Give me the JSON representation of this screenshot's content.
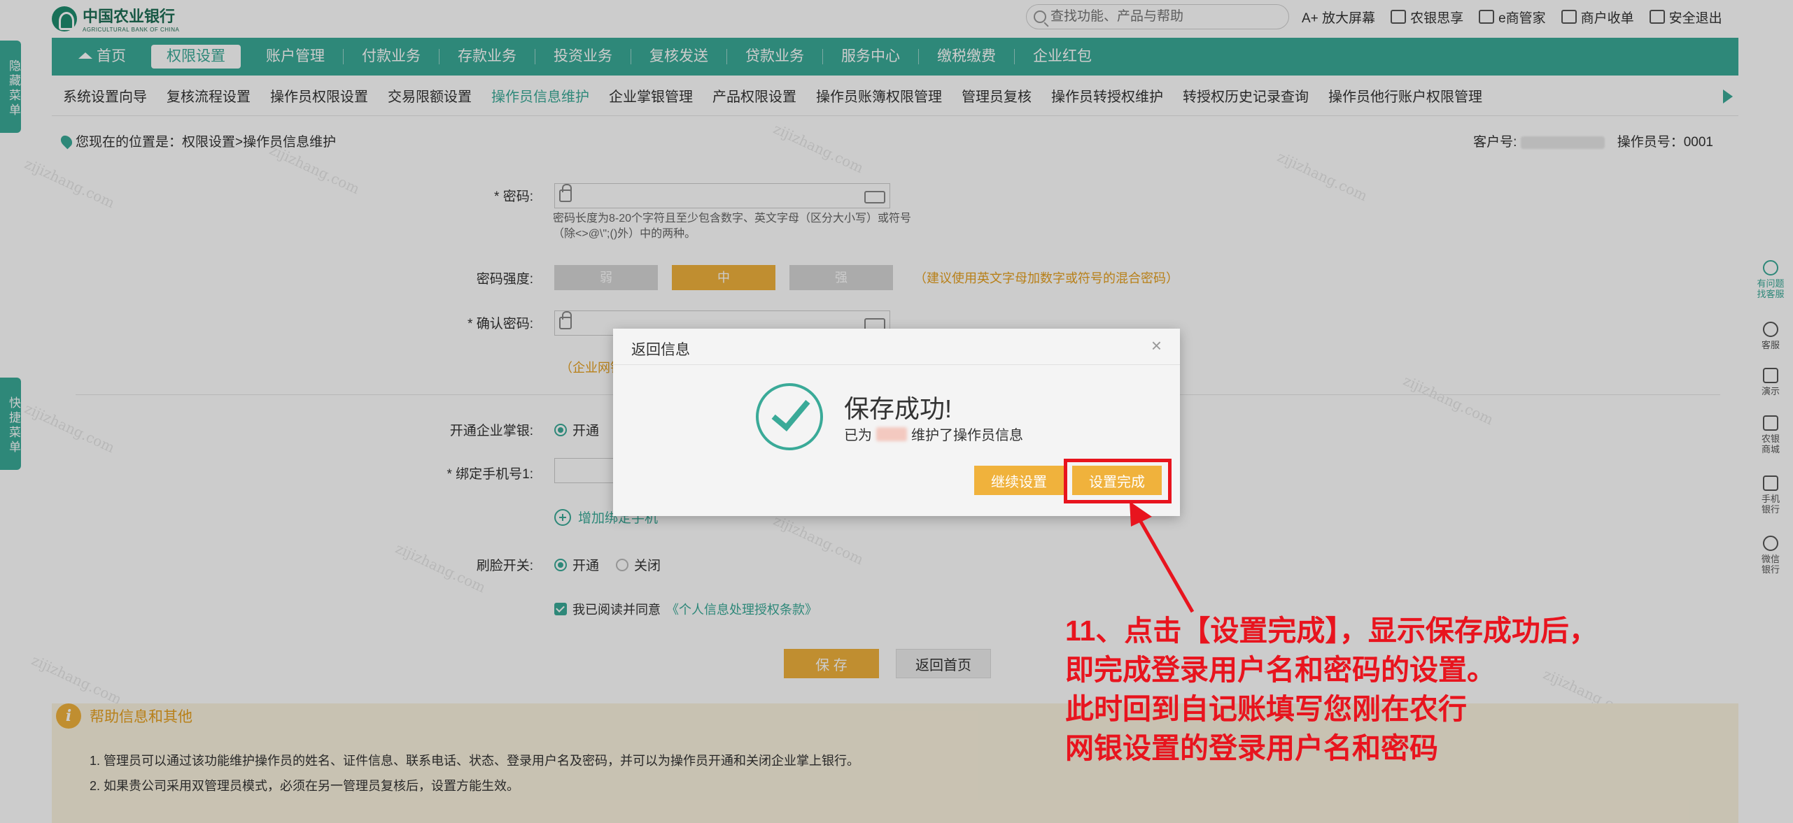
{
  "top": {
    "logo_cn": "中国农业银行",
    "logo_en": "AGRICULTURAL BANK OF CHINA",
    "search_placeholder": "查找功能、产品与帮助",
    "links": [
      "A+ 放大屏幕",
      "农银思享",
      "e商管家",
      "商户收单",
      "安全退出"
    ]
  },
  "nav": {
    "home": "首页",
    "items": [
      "权限设置",
      "账户管理",
      "付款业务",
      "存款业务",
      "投资业务",
      "复核发送",
      "贷款业务",
      "服务中心",
      "缴税缴费",
      "企业红包"
    ]
  },
  "subnav": [
    "系统设置向导",
    "复核流程设置",
    "操作员权限设置",
    "交易限额设置",
    "操作员信息维护",
    "企业掌银管理",
    "产品权限设置",
    "操作员账簿权限管理",
    "管理员复核",
    "操作员转授权维护",
    "转授权历史记录查询",
    "操作员他行账户权限管理"
  ],
  "breadcrumb": {
    "text": "您现在的位置是：权限设置>操作员信息维护",
    "customer_label": "客户号:",
    "operator_label": "操作员号：",
    "operator_no": "0001"
  },
  "form": {
    "password_label": "* 密码:",
    "password_hint": "密码长度为8-20个字符且至少包含数字、英文字母（区分大小写）或符号（除<>@\\\";()外）中的两种。",
    "strength_label": "密码强度:",
    "strength": [
      "弱",
      "中",
      "强"
    ],
    "strength_tip": "（建议使用英文字母加数字或符号的混合密码）",
    "confirm_label": "* 确认密码:",
    "note": "（企业网银",
    "mobile_bank_label": "开通企业掌银:",
    "open": "开通",
    "phone_label": "* 绑定手机号1:",
    "add_phone": "增加绑定手机",
    "face_label": "刷脸开关:",
    "close": "关闭",
    "agree_prefix": "我已阅读并同意",
    "agree_link": "《个人信息处理授权条款》",
    "save": "保 存",
    "back": "返回首页"
  },
  "help": {
    "title": "帮助信息和其他",
    "lines": [
      "1. 管理员可以通过该功能维护操作员的姓名、证件信息、联系电话、状态、登录用户名及密码，并可以为操作员开通和关闭企业掌上银行。",
      "2. 如果贵公司采用双管理员模式，必须在另一管理员复核后，设置方能生效。"
    ]
  },
  "side": {
    "left_tabs": [
      "隐藏菜单",
      "快捷菜单"
    ],
    "right_rail": [
      "有问题\n找客服",
      "客服",
      "演示",
      "农银\n商城",
      "手机\n银行",
      "微信\n银行"
    ]
  },
  "modal": {
    "title": "返回信息",
    "close": "×",
    "success_title": "保存成功!",
    "success_prefix": "已为",
    "success_suffix": "维护了操作员信息",
    "continue": "继续设置",
    "done": "设置完成"
  },
  "annotation": {
    "lines": [
      "11、点击【设置完成】，显示保存成功后，",
      "即完成登录用户名和密码的设置。",
      "此时回到自记账填写您刚在农行",
      "网银设置的登录用户名和密码"
    ]
  },
  "watermark": "zijizhang.com",
  "colors": {
    "accent": "#3aaa98",
    "button": "#f0b23c",
    "annotation": "#e8141e"
  }
}
